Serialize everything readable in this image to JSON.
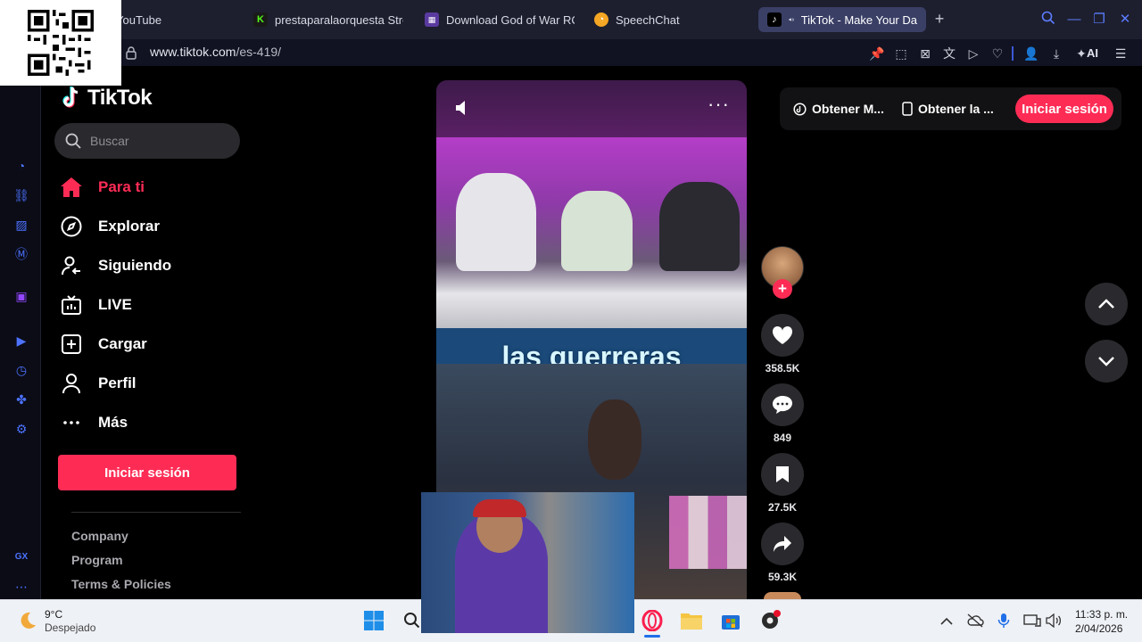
{
  "browser": {
    "tabs": [
      {
        "label": "YouTube",
        "favicon": "youtube-icon",
        "active": false
      },
      {
        "label": "prestaparalaorquesta Stre",
        "favicon": "kick-icon",
        "active": false
      },
      {
        "label": "Download God of War RON",
        "favicon": "download-site-icon",
        "active": false
      },
      {
        "label": "SpeechChat",
        "favicon": "speechchat-icon",
        "active": false
      },
      {
        "label": "TikTok - Make Your Da",
        "favicon": "tiktok-icon",
        "active": true
      }
    ],
    "url_host": "www.tiktok.com",
    "url_path": "/es-419/",
    "ai_label": "AI",
    "accent_color": "#4c72ff"
  },
  "tiktok": {
    "brand": "TikTok",
    "search_placeholder": "Buscar",
    "nav": [
      {
        "label": "Para ti",
        "icon": "home-icon",
        "active": true
      },
      {
        "label": "Explorar",
        "icon": "compass-icon",
        "active": false
      },
      {
        "label": "Siguiendo",
        "icon": "following-icon",
        "active": false
      },
      {
        "label": "LIVE",
        "icon": "live-tv-icon",
        "active": false
      },
      {
        "label": "Cargar",
        "icon": "upload-icon",
        "active": false
      },
      {
        "label": "Perfil",
        "icon": "profile-icon",
        "active": false
      },
      {
        "label": "Más",
        "icon": "more-icon",
        "active": false
      }
    ],
    "login_label": "Iniciar sesión",
    "footer_links": [
      "Company",
      "Program",
      "Terms & Policies"
    ],
    "brand_color": "#fe2c55"
  },
  "header": {
    "get_coins_label": "Obtener M...",
    "get_app_label": "Obtener la ...",
    "login_label": "Iniciar sesión"
  },
  "video": {
    "caption": "las guerreras",
    "likes": "358.5K",
    "comments": "849",
    "saves": "27.5K",
    "shares": "59.3K"
  },
  "taskbar": {
    "temperature": "9°C",
    "weather": "Despejado",
    "time": "11:33 p. m.",
    "date": "2/04/2026"
  }
}
